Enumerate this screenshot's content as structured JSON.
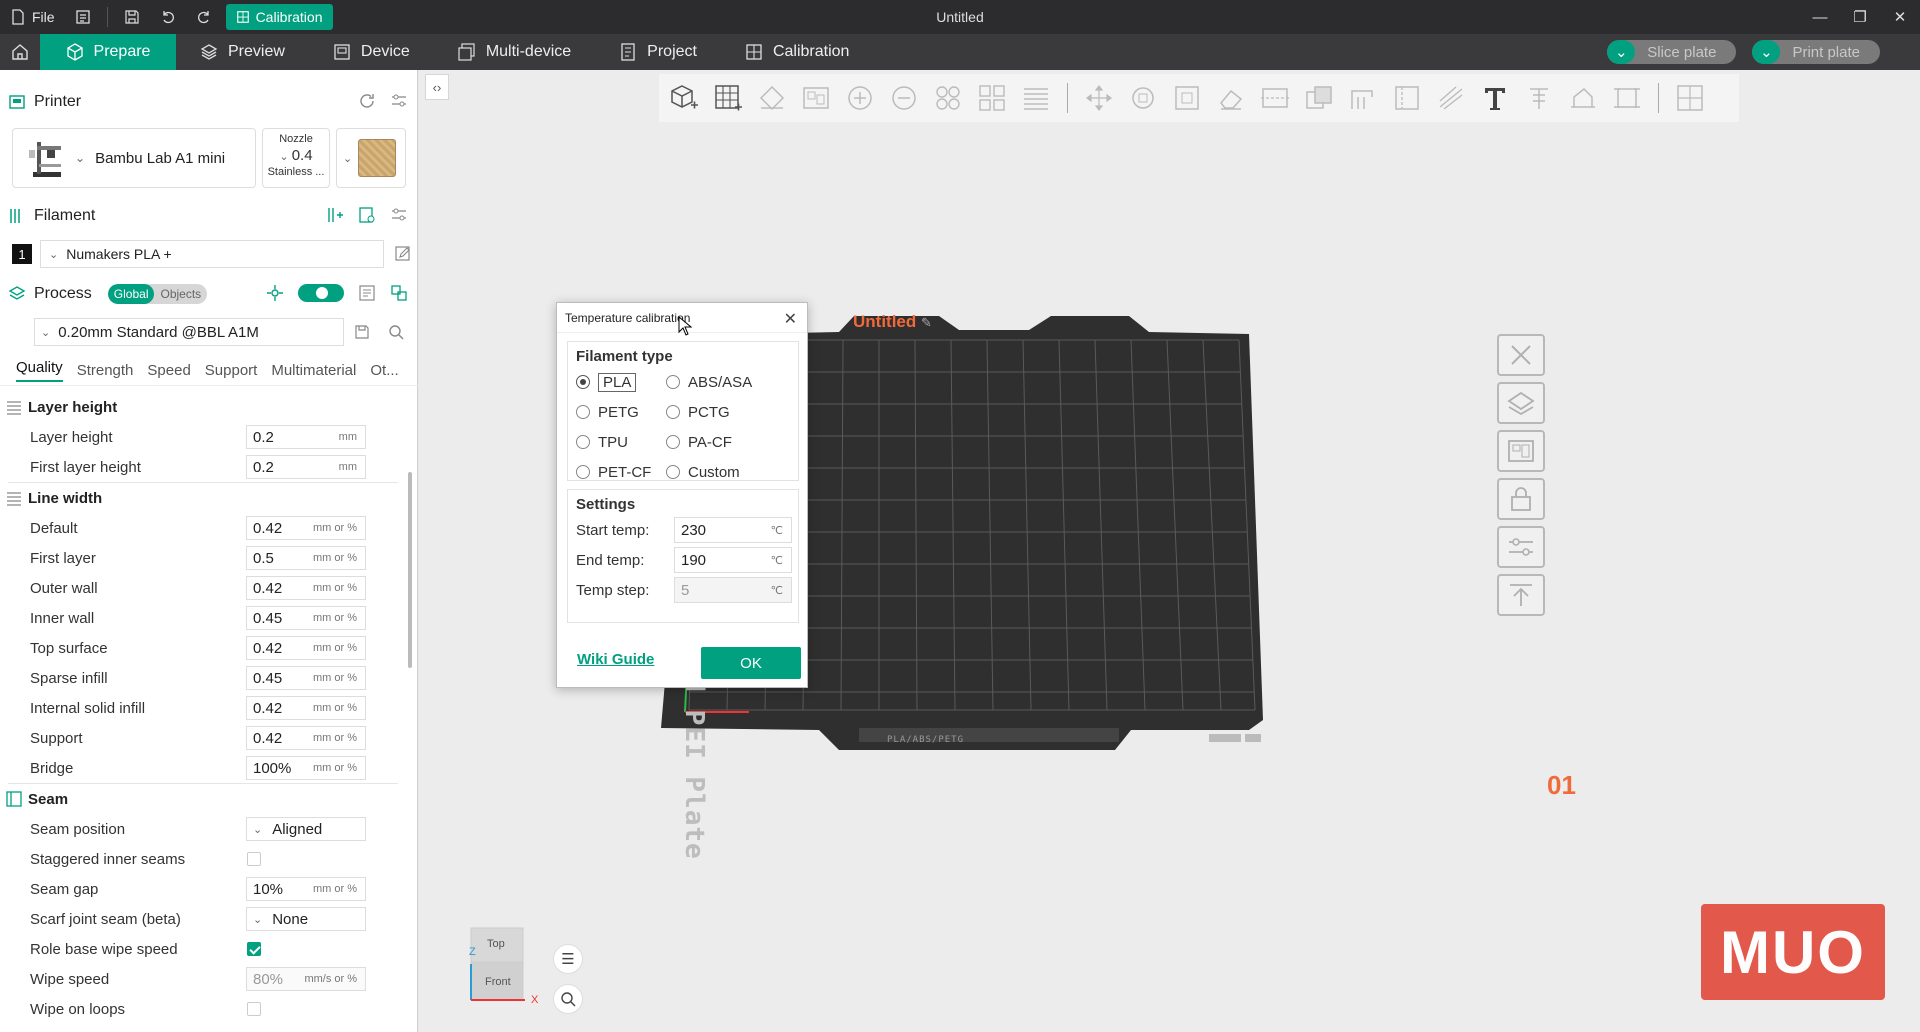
{
  "titlebar": {
    "file_label": "File",
    "calibration_label": "Calibration",
    "window_title": "Untitled"
  },
  "tabs": [
    {
      "label": "Prepare",
      "icon": "cube-icon"
    },
    {
      "label": "Preview",
      "icon": "layers-icon"
    },
    {
      "label": "Device",
      "icon": "device-icon"
    },
    {
      "label": "Multi-device",
      "icon": "multi-device-icon"
    },
    {
      "label": "Project",
      "icon": "project-icon"
    },
    {
      "label": "Calibration",
      "icon": "calibration-icon"
    }
  ],
  "actions": {
    "slice_label": "Slice plate",
    "print_label": "Print plate"
  },
  "printer": {
    "section_label": "Printer",
    "name": "Bambu Lab A1 mini",
    "nozzle_label": "Nozzle",
    "nozzle_value": "0.4",
    "nozzle_type": "Stainless ..."
  },
  "filament": {
    "section_label": "Filament",
    "slot_number": "1",
    "name": "Numakers PLA +"
  },
  "process": {
    "section_label": "Process",
    "scope_global": "Global",
    "scope_objects": "Objects",
    "preset": "0.20mm Standard @BBL A1M",
    "subtabs": [
      "Quality",
      "Strength",
      "Speed",
      "Support",
      "Multimaterial",
      "Ot..."
    ]
  },
  "settings": {
    "layer_height": {
      "group": "Layer height",
      "rows": [
        {
          "label": "Layer height",
          "value": "0.2",
          "unit": "mm"
        },
        {
          "label": "First layer height",
          "value": "0.2",
          "unit": "mm"
        }
      ]
    },
    "line_width": {
      "group": "Line width",
      "rows": [
        {
          "label": "Default",
          "value": "0.42",
          "unit": "mm or %"
        },
        {
          "label": "First layer",
          "value": "0.5",
          "unit": "mm or %"
        },
        {
          "label": "Outer wall",
          "value": "0.42",
          "unit": "mm or %"
        },
        {
          "label": "Inner wall",
          "value": "0.45",
          "unit": "mm or %"
        },
        {
          "label": "Top surface",
          "value": "0.42",
          "unit": "mm or %"
        },
        {
          "label": "Sparse infill",
          "value": "0.45",
          "unit": "mm or %"
        },
        {
          "label": "Internal solid infill",
          "value": "0.42",
          "unit": "mm or %"
        },
        {
          "label": "Support",
          "value": "0.42",
          "unit": "mm or %"
        },
        {
          "label": "Bridge",
          "value": "100%",
          "unit": "mm or %"
        }
      ]
    },
    "seam": {
      "group": "Seam",
      "seam_position_label": "Seam position",
      "seam_position_value": "Aligned",
      "staggered_label": "Staggered inner seams",
      "staggered_checked": false,
      "seam_gap_label": "Seam gap",
      "seam_gap_value": "10%",
      "seam_gap_unit": "mm or %",
      "scarf_label": "Scarf joint seam (beta)",
      "scarf_value": "None",
      "role_wipe_label": "Role base wipe speed",
      "role_wipe_checked": true,
      "wipe_speed_label": "Wipe speed",
      "wipe_speed_value": "80%",
      "wipe_speed_unit": "mm/s or %",
      "wipe_loops_label": "Wipe on loops",
      "wipe_loops_checked": false
    }
  },
  "viewport": {
    "plate_title": "Untitled",
    "plate_number": "01",
    "bed_text": "Bambu Textured PEI Plate",
    "bed_footer": "PLA/ABS/PETG",
    "cube_top": "Top",
    "cube_front": "Front",
    "axis_z": "Z",
    "axis_x": "X",
    "watermark": "MUO"
  },
  "dialog": {
    "title": "Temperature calibration",
    "filament_type_label": "Filament type",
    "options": [
      "PLA",
      "ABS/ASA",
      "PETG",
      "PCTG",
      "TPU",
      "PA-CF",
      "PET-CF",
      "Custom"
    ],
    "selected": "PLA",
    "settings_label": "Settings",
    "start_temp_label": "Start temp:",
    "start_temp_value": "230",
    "end_temp_label": "End temp:",
    "end_temp_value": "190",
    "temp_step_label": "Temp step:",
    "temp_step_value": "5",
    "temp_unit": "℃",
    "wiki_label": "Wiki Guide",
    "ok_label": "OK"
  },
  "colors": {
    "accent": "#00a080",
    "plate_label": "#f06a3c",
    "titlebar_bg": "#2c2c2e"
  }
}
